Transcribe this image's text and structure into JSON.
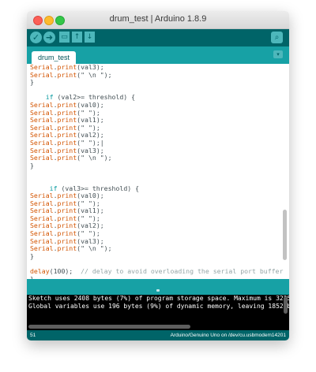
{
  "window": {
    "title": "drum_test | Arduino 1.8.9"
  },
  "toolbar": {
    "verify": "✓",
    "upload": "➜",
    "new": "▭",
    "open": "↑",
    "save": "↓",
    "serial_monitor": "⌕"
  },
  "tabs": [
    {
      "label": "drum_test"
    }
  ],
  "tab_menu": "▾",
  "code_lines": [
    {
      "parts": [
        [
          "fn",
          "Serial"
        ],
        [
          "",
          "."
        ],
        [
          "fn",
          "print"
        ],
        [
          "",
          "(val3);"
        ]
      ]
    },
    {
      "parts": [
        [
          "fn",
          "Serial"
        ],
        [
          "",
          "."
        ],
        [
          "fn",
          "print"
        ],
        [
          "",
          "(\" \\n \");"
        ]
      ]
    },
    {
      "parts": [
        [
          "",
          "}"
        ]
      ]
    },
    {
      "parts": [
        [
          "",
          ""
        ]
      ]
    },
    {
      "parts": [
        [
          "",
          "    "
        ],
        [
          "kw",
          "if"
        ],
        [
          "",
          " (val2>= threshold) {"
        ]
      ]
    },
    {
      "parts": [
        [
          "fn",
          "Serial"
        ],
        [
          "",
          "."
        ],
        [
          "fn",
          "print"
        ],
        [
          "",
          "(val0);"
        ]
      ]
    },
    {
      "parts": [
        [
          "fn",
          "Serial"
        ],
        [
          "",
          "."
        ],
        [
          "fn",
          "print"
        ],
        [
          "",
          "(\" \");"
        ]
      ]
    },
    {
      "parts": [
        [
          "fn",
          "Serial"
        ],
        [
          "",
          "."
        ],
        [
          "fn",
          "print"
        ],
        [
          "",
          "(val1);"
        ]
      ]
    },
    {
      "parts": [
        [
          "fn",
          "Serial"
        ],
        [
          "",
          "."
        ],
        [
          "fn",
          "print"
        ],
        [
          "",
          "(\" \");"
        ]
      ]
    },
    {
      "parts": [
        [
          "fn",
          "Serial"
        ],
        [
          "",
          "."
        ],
        [
          "fn",
          "print"
        ],
        [
          "",
          "(val2);"
        ]
      ]
    },
    {
      "parts": [
        [
          "fn",
          "Serial"
        ],
        [
          "",
          "."
        ],
        [
          "fn",
          "print"
        ],
        [
          "",
          "(\" \");|"
        ]
      ]
    },
    {
      "parts": [
        [
          "fn",
          "Serial"
        ],
        [
          "",
          "."
        ],
        [
          "fn",
          "print"
        ],
        [
          "",
          "(val3);"
        ]
      ]
    },
    {
      "parts": [
        [
          "fn",
          "Serial"
        ],
        [
          "",
          "."
        ],
        [
          "fn",
          "print"
        ],
        [
          "",
          "(\" \\n \");"
        ]
      ]
    },
    {
      "parts": [
        [
          "",
          "}"
        ]
      ]
    },
    {
      "parts": [
        [
          "",
          ""
        ]
      ]
    },
    {
      "parts": [
        [
          "",
          ""
        ]
      ]
    },
    {
      "parts": [
        [
          "",
          "     "
        ],
        [
          "kw",
          "if"
        ],
        [
          "",
          " (val3>= threshold) {"
        ]
      ]
    },
    {
      "parts": [
        [
          "fn",
          "Serial"
        ],
        [
          "",
          "."
        ],
        [
          "fn",
          "print"
        ],
        [
          "",
          "(val0);"
        ]
      ]
    },
    {
      "parts": [
        [
          "fn",
          "Serial"
        ],
        [
          "",
          "."
        ],
        [
          "fn",
          "print"
        ],
        [
          "",
          "(\" \");"
        ]
      ]
    },
    {
      "parts": [
        [
          "fn",
          "Serial"
        ],
        [
          "",
          "."
        ],
        [
          "fn",
          "print"
        ],
        [
          "",
          "(val1);"
        ]
      ]
    },
    {
      "parts": [
        [
          "fn",
          "Serial"
        ],
        [
          "",
          "."
        ],
        [
          "fn",
          "print"
        ],
        [
          "",
          "(\" \");"
        ]
      ]
    },
    {
      "parts": [
        [
          "fn",
          "Serial"
        ],
        [
          "",
          "."
        ],
        [
          "fn",
          "print"
        ],
        [
          "",
          "(val2);"
        ]
      ]
    },
    {
      "parts": [
        [
          "fn",
          "Serial"
        ],
        [
          "",
          "."
        ],
        [
          "fn",
          "print"
        ],
        [
          "",
          "(\" \");"
        ]
      ]
    },
    {
      "parts": [
        [
          "fn",
          "Serial"
        ],
        [
          "",
          "."
        ],
        [
          "fn",
          "print"
        ],
        [
          "",
          "(val3);"
        ]
      ]
    },
    {
      "parts": [
        [
          "fn",
          "Serial"
        ],
        [
          "",
          "."
        ],
        [
          "fn",
          "print"
        ],
        [
          "",
          "(\" \\n \");"
        ]
      ]
    },
    {
      "parts": [
        [
          "",
          "}"
        ]
      ]
    },
    {
      "parts": [
        [
          "",
          ""
        ]
      ]
    },
    {
      "parts": [
        [
          "fn",
          "delay"
        ],
        [
          "",
          "(100);  "
        ],
        [
          "cm",
          "// delay to avoid overloading the serial port buffer"
        ]
      ]
    },
    {
      "parts": [
        [
          "",
          "}"
        ]
      ]
    }
  ],
  "console": {
    "lines": [
      "Sketch uses 2408 bytes (7%) of program storage space. Maximum is 32256 bytes.",
      "Global variables use 196 bytes (9%) of dynamic memory, leaving 1852 bytes for"
    ]
  },
  "status": {
    "line": "51",
    "board": "Arduino/Genuino Uno on /dev/cu.usbmodem14201"
  }
}
